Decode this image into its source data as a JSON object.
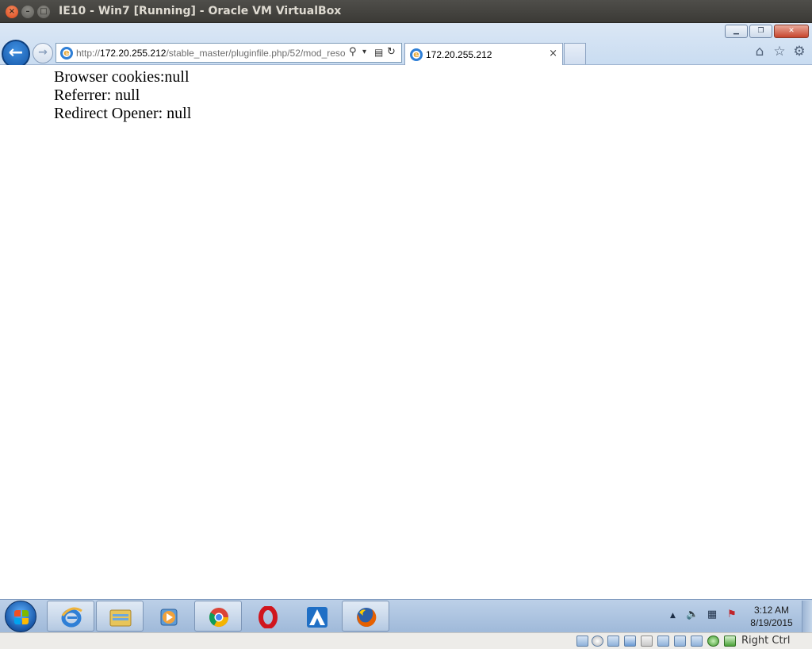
{
  "host_window": {
    "title": "IE10 - Win7 [Running] - Oracle VM VirtualBox",
    "close_glyph": "×",
    "minimize_glyph": "–",
    "maximize_glyph": "□"
  },
  "browser": {
    "window_controls": {
      "minimize": "▁",
      "restore": "❐",
      "close": "✕"
    },
    "back_glyph": "←",
    "forward_glyph": "→",
    "address": {
      "prefix": "http://",
      "host": "172.20.255.212",
      "path": "/stable_master/pluginfile.php/52/mod_reso",
      "search_glyph": "⚲",
      "dropdown_glyph": "▾",
      "compat_glyph": "▤",
      "refresh_glyph": "↻"
    },
    "tab": {
      "title": "172.20.255.212",
      "close_glyph": "×"
    },
    "toolbar": {
      "home_glyph": "⌂",
      "favorites_glyph": "☆",
      "tools_glyph": "⚙"
    }
  },
  "page": {
    "lines": [
      "Browser cookies:null",
      "Referrer: null",
      "Redirect Opener: null"
    ]
  },
  "taskbar": {
    "pinned": [
      {
        "name": "internet-explorer",
        "active": true
      },
      {
        "name": "windows-explorer",
        "active": true
      },
      {
        "name": "media-player",
        "active": false
      },
      {
        "name": "chrome",
        "active": true
      },
      {
        "name": "opera",
        "active": false
      },
      {
        "name": "arora",
        "active": false
      },
      {
        "name": "firefox",
        "active": true
      }
    ],
    "tray": {
      "overflow_glyph": "▲",
      "volume_glyph": "🔈",
      "network_glyph": "▦",
      "action_center_glyph": "⚑"
    },
    "clock": {
      "time": "3:12 AM",
      "date": "8/19/2015"
    }
  },
  "vbox_status": {
    "host_key": "Right Ctrl"
  },
  "colors": {
    "ie_blue": "#1657a8",
    "taskbar": "#bcd0e8",
    "host_titlebar": "#3b3a36"
  }
}
